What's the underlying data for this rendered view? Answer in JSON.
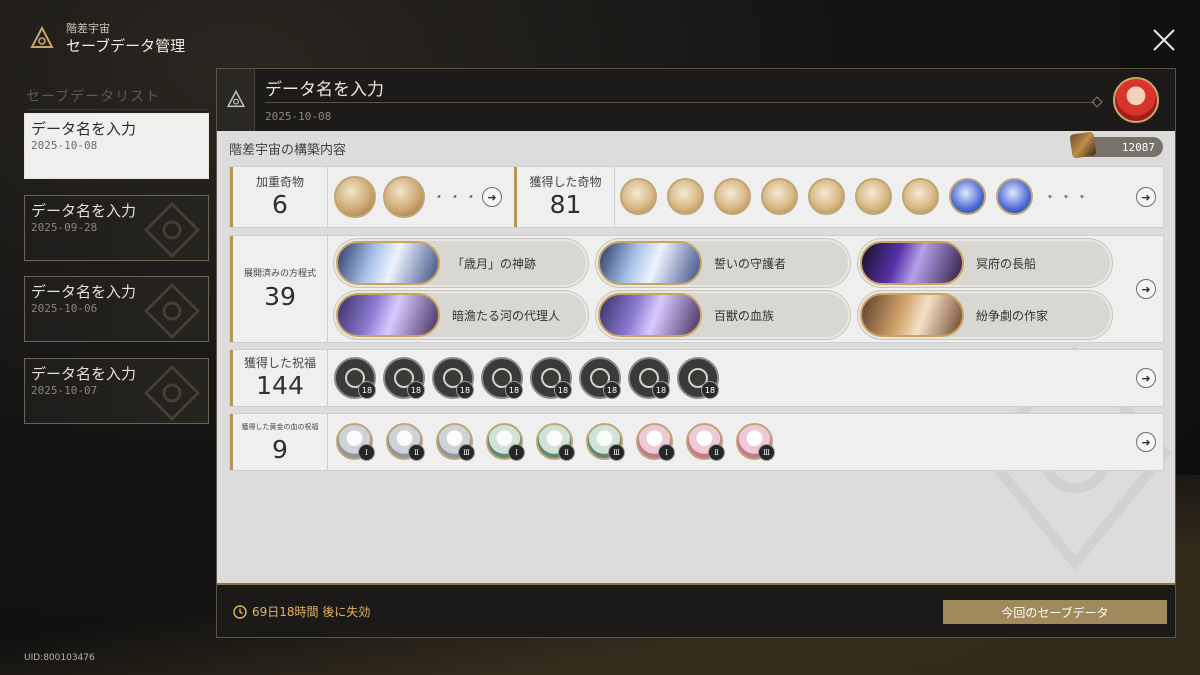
{
  "app": {
    "subtitle": "階差宇宙",
    "title": "セーブデータ管理",
    "uid": "UID:800103476"
  },
  "sidebar": {
    "title": "セーブデータリスト",
    "slots": [
      {
        "name": "データ名を入力",
        "date": "2025-10-08"
      },
      {
        "name": "データ名を入力",
        "date": "2025-09-28"
      },
      {
        "name": "データ名を入力",
        "date": "2025-10-06"
      },
      {
        "name": "データ名を入力",
        "date": "2025-10-07"
      }
    ]
  },
  "detail": {
    "name": "データ名を入力",
    "date": "2025-10-08",
    "section_title": "階差宇宙の構築内容",
    "currency": "12087",
    "weighted_curios": {
      "label": "加重奇物",
      "count": "6"
    },
    "obtained_curios": {
      "label": "獲得した奇物",
      "count": "81"
    },
    "equations": {
      "label": "展開済みの方程式",
      "count": "39",
      "items": [
        "「歳月」の神跡",
        "誓いの守護者",
        "冥府の長船",
        "暗澹たる河の代理人",
        "百獣の血族",
        "紛争劇の作家"
      ]
    },
    "blessings": {
      "label": "獲得した祝福",
      "count": "144",
      "level": "18"
    },
    "golden_blessings": {
      "label": "獲得した黄金の血の祝福",
      "count": "9",
      "tiers": [
        "Ⅰ",
        "Ⅱ",
        "Ⅲ",
        "Ⅰ",
        "Ⅱ",
        "Ⅲ",
        "Ⅰ",
        "Ⅱ",
        "Ⅲ"
      ]
    },
    "more_dots": "・・・"
  },
  "footer": {
    "timer": "69日18時間 後に失効",
    "button": "今回のセーブデータ"
  },
  "colors": {
    "accent_gold": "#b3955a",
    "timer": "#e3b65c",
    "button": "#a08a5c"
  }
}
